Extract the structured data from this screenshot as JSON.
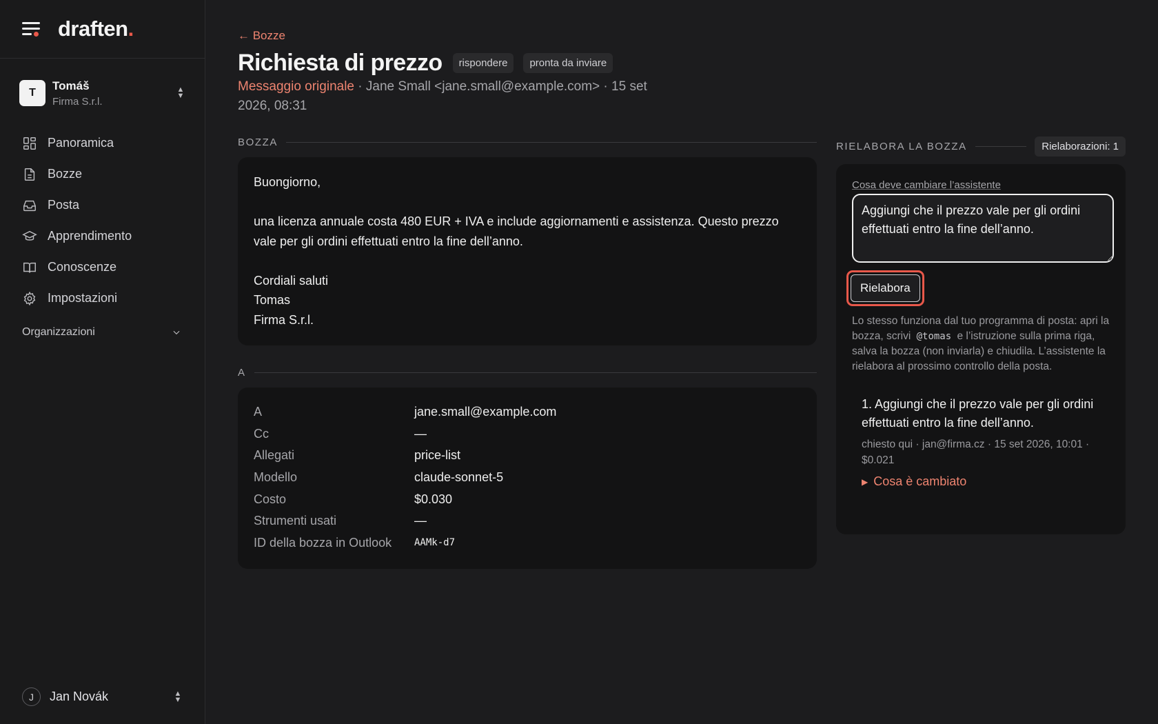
{
  "brand": {
    "logo": "draften",
    "logo_dot": "."
  },
  "org": {
    "initial": "T",
    "name": "Tomáš",
    "company": "Firma S.r.l."
  },
  "nav": {
    "items": [
      {
        "label": "Panoramica",
        "icon": "grid-icon"
      },
      {
        "label": "Bozze",
        "icon": "document-icon"
      },
      {
        "label": "Posta",
        "icon": "inbox-icon"
      },
      {
        "label": "Apprendimento",
        "icon": "graduation-cap-icon"
      },
      {
        "label": "Conoscenze",
        "icon": "book-icon"
      },
      {
        "label": "Impostazioni",
        "icon": "gear-icon"
      }
    ],
    "orgs_label": "Organizzazioni"
  },
  "user": {
    "initial": "J",
    "name": "Jan Novák"
  },
  "header": {
    "back_label": "← Bozze",
    "title": "Richiesta di prezzo",
    "badges": [
      "rispondere",
      "pronta da inviare"
    ],
    "meta_link": "Messaggio originale",
    "meta_text": " · Jane Small <jane.small@example.com> · 15 set 2026, 08:31"
  },
  "draft": {
    "section_label": "BOZZA",
    "paragraphs": [
      "Buongiorno,",
      "una licenza annuale costa 480 EUR + IVA e include aggiornamenti e assistenza. Questo prezzo vale per gli ordini effettuati entro la fine dell’anno.",
      "Cordiali saluti",
      "Tomas",
      "Firma S.r.l."
    ]
  },
  "recipients": {
    "section_label": "A",
    "rows": [
      {
        "key": "A",
        "value": "jane.small@example.com"
      },
      {
        "key": "Cc",
        "value": "—"
      },
      {
        "key": "Allegati",
        "value": "price-list"
      },
      {
        "key": "Modello",
        "value": "claude-sonnet-5"
      },
      {
        "key": "Costo",
        "value": "$0.030"
      },
      {
        "key": "Strumenti usati",
        "value": "—"
      },
      {
        "key": "ID della bozza in Outlook",
        "value": "AAMk-d7"
      }
    ]
  },
  "rework": {
    "section_label": "RIELABORA LA BOZZA",
    "count_label": "Rielaborazioni: 1",
    "field_label": "Cosa deve cambiare l’assistente",
    "instruction_value": "Aggiungi che il prezzo vale per gli ordini effettuati entro la fine dell’anno.",
    "button_label": "Rielabora",
    "hint_before": "Lo stesso funziona dal tuo programma di posta: apri la bozza, scrivi",
    "hint_code": "@tomas",
    "hint_after": "e l’istruzione sulla prima riga, salva la bozza (non inviarla) e chiudila. L’assistente la rielabora al prossimo controllo della posta.",
    "history": [
      {
        "text": "1. Aggiungi che il prezzo vale per gli ordini effettuati entro la fine dell’anno.",
        "meta": "chiesto qui · jan@firma.cz · 15 set 2026, 10:01 · $0.021",
        "toggle": "Cosa è cambiato"
      }
    ]
  },
  "colors": {
    "accent": "#e8584a",
    "link": "#ee8470",
    "background": "#1c1c1e",
    "card": "#131314"
  }
}
